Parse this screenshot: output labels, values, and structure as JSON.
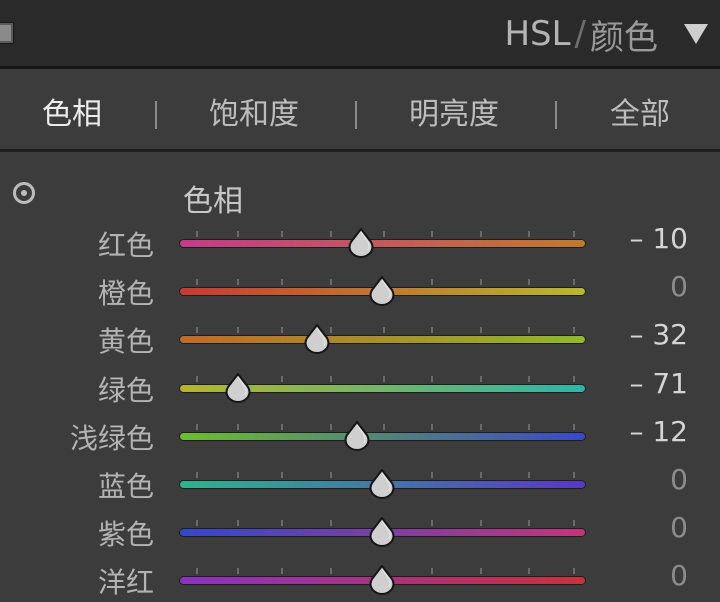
{
  "header": {
    "title_hsl": "HSL",
    "title_sep": "/",
    "title_cn": "颜色"
  },
  "tabs": [
    {
      "label": "色相",
      "active": true
    },
    {
      "label": "饱和度",
      "active": false
    },
    {
      "label": "明亮度",
      "active": false
    },
    {
      "label": "全部",
      "active": false
    }
  ],
  "section": {
    "label": "色相"
  },
  "sliders": [
    {
      "label": "红色",
      "value": "– 10",
      "numeric": -10,
      "gradient": [
        "#c23b8a",
        "#c07a2e"
      ]
    },
    {
      "label": "橙色",
      "value": "0",
      "numeric": 0,
      "gradient": [
        "#c63a32",
        "#b8b832"
      ]
    },
    {
      "label": "黄色",
      "value": "– 32",
      "numeric": -32,
      "gradient": [
        "#c06a2a",
        "#8fb82e"
      ]
    },
    {
      "label": "绿色",
      "value": "– 71",
      "numeric": -71,
      "gradient": [
        "#b5b52e",
        "#2eb5a8"
      ]
    },
    {
      "label": "浅绿色",
      "value": "– 12",
      "numeric": -12,
      "gradient": [
        "#6cbf2e",
        "#3a48c8"
      ]
    },
    {
      "label": "蓝色",
      "value": "0",
      "numeric": 0,
      "gradient": [
        "#2eb58a",
        "#5a36c4"
      ]
    },
    {
      "label": "紫色",
      "value": "0",
      "numeric": 0,
      "gradient": [
        "#3448c8",
        "#c2367a"
      ]
    },
    {
      "label": "洋红",
      "value": "0",
      "numeric": 0,
      "gradient": [
        "#8a32c4",
        "#c8323a"
      ]
    }
  ],
  "colors": {
    "background": "#3c3c3c",
    "header_background": "#2a2a2a",
    "text_active": "#ececec",
    "text_zero": "#8c8c8c"
  },
  "icons": {
    "collapse_square": "panel-switch-icon",
    "collapse_arrow": "collapse-triangle-icon",
    "target": "targeted-adjustment-icon"
  }
}
